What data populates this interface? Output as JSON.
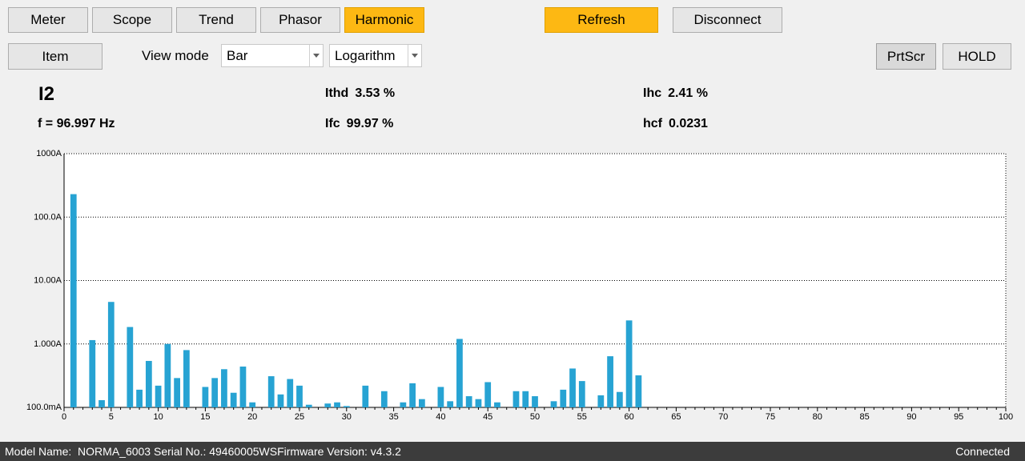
{
  "tabs": [
    {
      "label": "Meter",
      "active": false
    },
    {
      "label": "Scope",
      "active": false
    },
    {
      "label": "Trend",
      "active": false
    },
    {
      "label": "Phasor",
      "active": false
    },
    {
      "label": "Harmonic",
      "active": true
    }
  ],
  "actions": {
    "refresh": "Refresh",
    "disconnect": "Disconnect"
  },
  "toolbar": {
    "item": "Item",
    "view_mode_label": "View mode",
    "view_mode_value": "Bar",
    "scale_value": "Logarithm",
    "prtscr": "PrtScr",
    "hold": "HOLD"
  },
  "measurements": {
    "channel": "I2",
    "freq": "f = 96.997 Hz",
    "ithd_label": "Ithd",
    "ithd_value": "3.53 %",
    "ifc_label": "Ifc",
    "ifc_value": "99.97 %",
    "ihc_label": "Ihc",
    "ihc_value": "2.41 %",
    "hcf_label": "hcf",
    "hcf_value": "0.0231"
  },
  "colors": {
    "accent": "#fdb813",
    "bar": "#27a3d3",
    "status_bg": "#3c3c3c"
  },
  "chart_data": {
    "type": "bar",
    "yscale": "log",
    "ylim": [
      0.1,
      1000
    ],
    "xlim": [
      0,
      100
    ],
    "yticks": [
      "100.0mA",
      "1.000A",
      "10.00A",
      "100.0A",
      "1000A"
    ],
    "xticks": [
      "0",
      "5",
      "10",
      "15",
      "20",
      "25",
      "30",
      "35",
      "40",
      "45",
      "50",
      "55",
      "60",
      "65",
      "70",
      "75",
      "80",
      "85",
      "90",
      "95",
      "100"
    ],
    "grid": true,
    "harmonics": [
      1,
      2,
      3,
      4,
      5,
      6,
      7,
      8,
      9,
      10,
      11,
      12,
      13,
      14,
      15,
      16,
      17,
      18,
      19,
      20,
      21,
      22,
      23,
      24,
      25,
      26,
      27,
      28,
      29,
      30,
      31,
      32,
      33,
      34,
      35,
      36,
      37,
      38,
      39,
      40,
      41,
      42,
      43,
      44,
      45,
      46,
      47,
      48,
      49,
      50,
      51,
      52,
      53,
      54,
      55,
      56,
      57,
      58,
      59,
      60,
      61
    ],
    "values": [
      230,
      0,
      1.15,
      0.13,
      4.6,
      0,
      1.85,
      0.19,
      0.54,
      0.22,
      1.0,
      0.29,
      0.8,
      0,
      0.21,
      0.29,
      0.4,
      0.17,
      0.44,
      0.12,
      0,
      0.31,
      0.16,
      0.28,
      0.22,
      0.11,
      0,
      0.115,
      0.12,
      0.105,
      0,
      0.22,
      0,
      0.18,
      0,
      0.12,
      0.24,
      0.135,
      0,
      0.21,
      0.125,
      1.2,
      0.15,
      0.135,
      0.25,
      0.12,
      0,
      0.18,
      0.18,
      0.15,
      0,
      0.125,
      0.19,
      0.41,
      0.26,
      0,
      0.155,
      0.64,
      0.175,
      2.35,
      0.32
    ]
  },
  "status": {
    "model_label": "Model Name:",
    "model_value": "NORMA_6003",
    "serial_label": "Serial No.:",
    "serial_value": "49460005WS",
    "firmware_label": "Firmware Version:",
    "firmware_value": "v4.3.2",
    "connection": "Connected"
  }
}
